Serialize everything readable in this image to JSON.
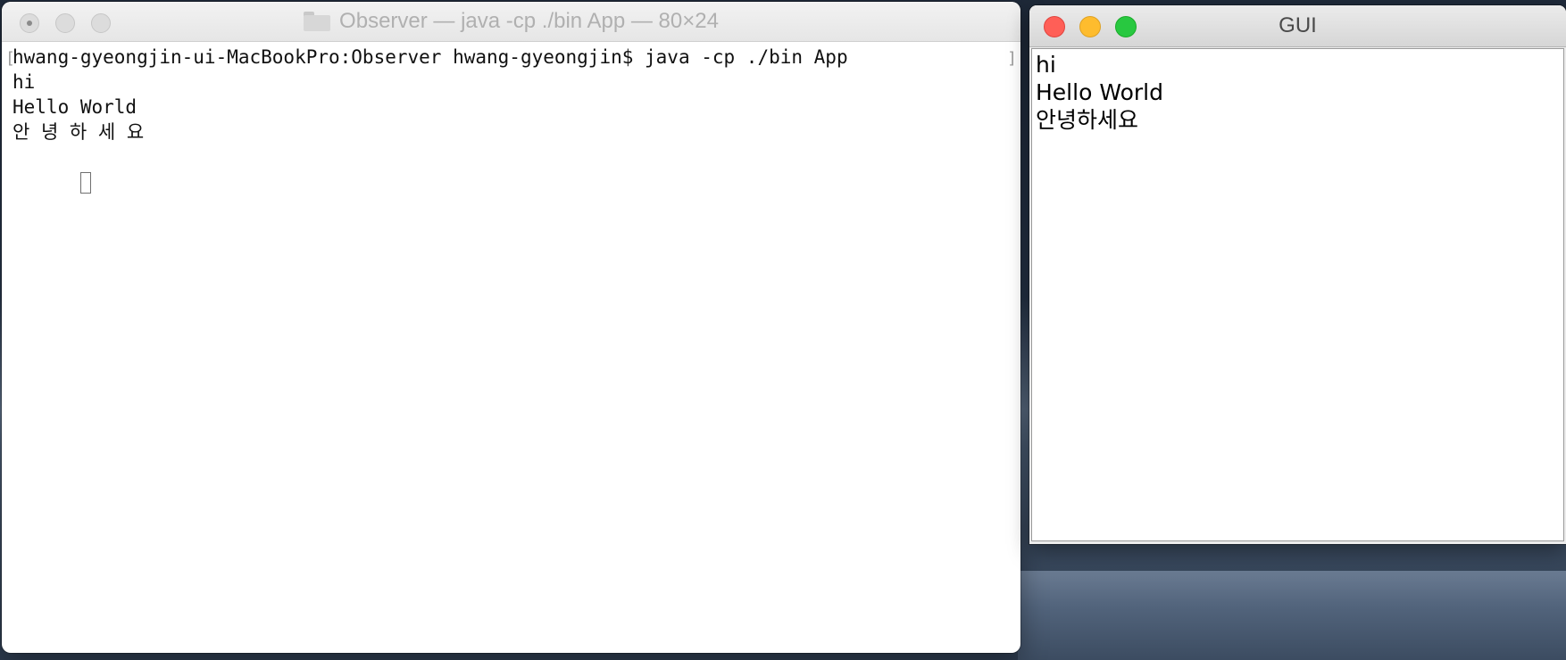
{
  "terminal": {
    "title": "Observer — java -cp ./bin App — 80×24",
    "icon": "folder-icon",
    "bracket_left": "[",
    "bracket_right": "]",
    "lines": [
      "hwang-gyeongjin-ui-MacBookPro:Observer hwang-gyeongjin$ java -cp ./bin App",
      "hi",
      "Hello World",
      "안 녕 하 세 요"
    ]
  },
  "gui_window": {
    "title": "GUI",
    "lines": [
      "hi",
      "Hello World",
      "안녕하세요"
    ],
    "colors": {
      "close": "#ff5f57",
      "minimize": "#febc2e",
      "maximize": "#28c840"
    }
  }
}
